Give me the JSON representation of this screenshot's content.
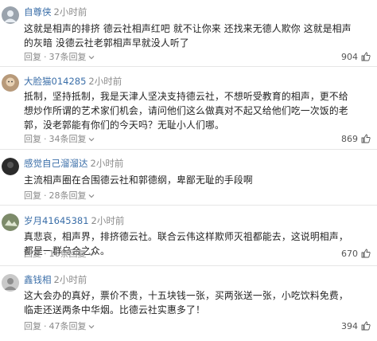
{
  "comments": [
    {
      "username": "自尊侠",
      "time": "2小时前",
      "text": "这就是相声的排挤 德云社相声红吧 就不让你来 还找来无德人欺你 这就是相声的灰暗 没德云社老郭相声早就没人听了",
      "reply": "回复",
      "replies": "37条回复",
      "likes": "904"
    },
    {
      "username": "大脸猫014285",
      "time": "2小时前",
      "text": "抵制，坚持抵制，我是天津人坚决支持德云社，不想听受教育的相声，更不给想炒作所谓的艺术家们机会，请问他们这么做真对不起又给他们吃一次饭的老郭，没老郭能有你们的今天吗？无耻小人们哪。",
      "reply": "回复",
      "replies": "34条回复",
      "likes": "869"
    },
    {
      "username": "感觉自己溜溜达",
      "time": "2小时前",
      "text": "主流相声圈在合围德云社和郭德纲，卑鄙无耻的手段啊",
      "reply": "回复",
      "replies": "28条回复",
      "likes": ""
    },
    {
      "username": "岁月41645381",
      "time": "2小时前",
      "text": "真悲哀，相声界，排挤德云社。联合云伟这样欺师灭祖都能去，这说明相声，都是一群乌合之众。",
      "reply": "回复",
      "replies": "16条回复",
      "likes": "670"
    },
    {
      "username": "鑫钱相",
      "time": "2小时前",
      "text": "这大会办的真好，票价不贵，十五块钱一张，买两张送一张，小吃饮料免费，临走还送两条中华烟。比德云社实惠多了！",
      "reply": "回复",
      "replies": "47条回复",
      "likes": "394"
    }
  ],
  "colors": {
    "username": "#3a6ea8",
    "meta": "#8a8a8a",
    "text": "#222222"
  },
  "icons": {
    "expand": "chevron-down-icon",
    "like": "thumbs-up-icon"
  }
}
